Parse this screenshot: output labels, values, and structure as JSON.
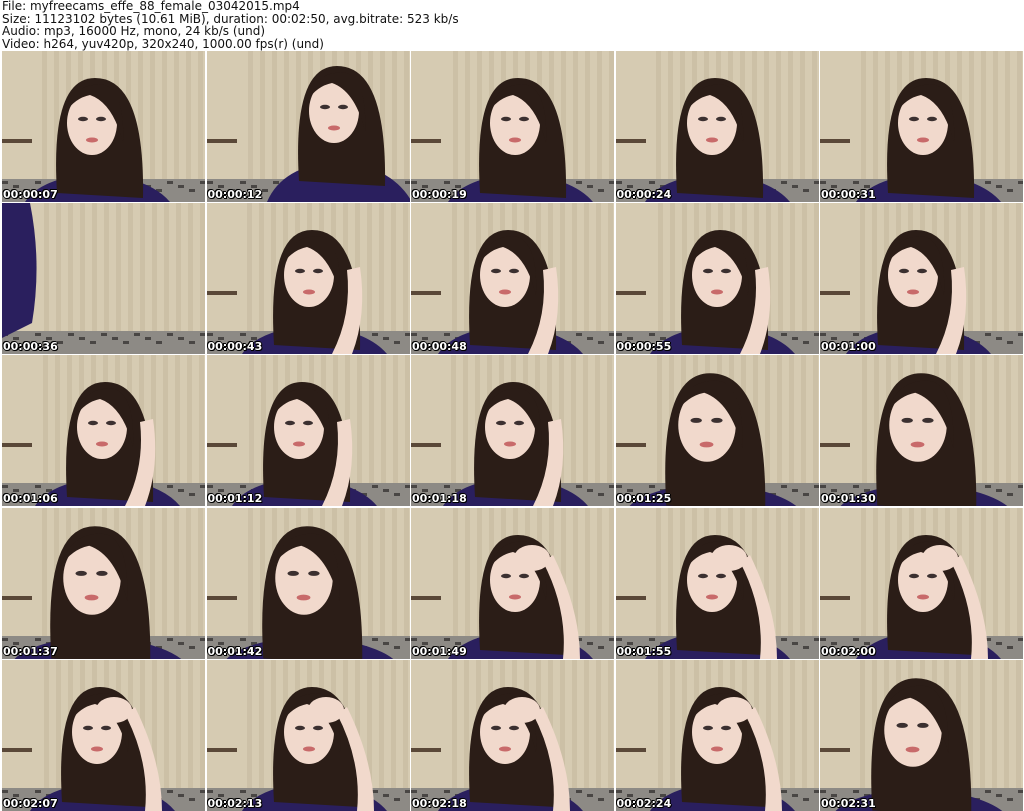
{
  "header": {
    "line1": "File: myfreecams_effe_88_female_03042015.mp4",
    "line2": "Size: 11123102 bytes (10.61 MiB), duration: 00:02:50, avg.bitrate: 523 kb/s",
    "line3": "Audio: mp3, 16000 Hz, mono, 24 kb/s (und)",
    "line4": "Video: h264, yuv420p, 320x240, 1000.00 fps(r) (und)"
  },
  "thumbnails": [
    {
      "time": "00:00:07",
      "scene": "face-center"
    },
    {
      "time": "00:00:12",
      "scene": "face-looking-up"
    },
    {
      "time": "00:00:19",
      "scene": "face-center"
    },
    {
      "time": "00:00:24",
      "scene": "face-center"
    },
    {
      "time": "00:00:31",
      "scene": "face-center"
    },
    {
      "time": "00:00:36",
      "scene": "empty-room"
    },
    {
      "time": "00:00:43",
      "scene": "hand-on-head"
    },
    {
      "time": "00:00:48",
      "scene": "hand-on-head"
    },
    {
      "time": "00:00:55",
      "scene": "hand-on-head"
    },
    {
      "time": "00:01:00",
      "scene": "hand-on-head"
    },
    {
      "time": "00:01:06",
      "scene": "hand-on-head"
    },
    {
      "time": "00:01:12",
      "scene": "hand-on-head"
    },
    {
      "time": "00:01:18",
      "scene": "hand-on-head"
    },
    {
      "time": "00:01:25",
      "scene": "face-close"
    },
    {
      "time": "00:01:30",
      "scene": "face-close"
    },
    {
      "time": "00:01:37",
      "scene": "face-close"
    },
    {
      "time": "00:01:42",
      "scene": "face-close"
    },
    {
      "time": "00:01:49",
      "scene": "hand-on-forehead"
    },
    {
      "time": "00:01:55",
      "scene": "hand-on-forehead"
    },
    {
      "time": "00:02:00",
      "scene": "hand-on-forehead"
    },
    {
      "time": "00:02:07",
      "scene": "hand-on-forehead"
    },
    {
      "time": "00:02:13",
      "scene": "hand-on-forehead"
    },
    {
      "time": "00:02:18",
      "scene": "hand-on-forehead"
    },
    {
      "time": "00:02:24",
      "scene": "hand-on-forehead"
    },
    {
      "time": "00:02:31",
      "scene": "face-close"
    }
  ],
  "colors": {
    "wall": "#d6cbb2",
    "curtain": "#c4b89e",
    "hair": "#2b1d17",
    "skin": "#f1d9cc",
    "robe": "#2a1f5e",
    "floor": "#8d8a85"
  }
}
